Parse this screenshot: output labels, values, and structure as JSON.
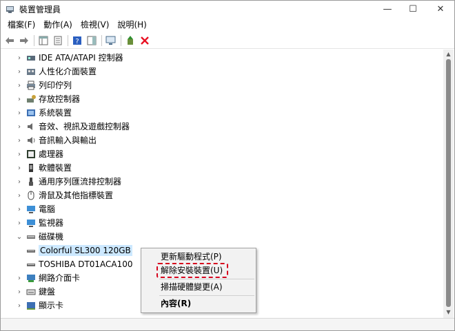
{
  "window": {
    "title": "裝置管理員",
    "minimize": "—",
    "maximize": "☐",
    "close": "✕"
  },
  "menu": [
    "檔案(F)",
    "動作(A)",
    "檢視(V)",
    "說明(H)"
  ],
  "tree": {
    "items": [
      {
        "label": "IDE ATA/ATAPI 控制器",
        "expander": "›",
        "icon": "ide-controller-icon"
      },
      {
        "label": "人性化介面裝置",
        "expander": "›",
        "icon": "hid-icon"
      },
      {
        "label": "列印佇列",
        "expander": "›",
        "icon": "printer-icon"
      },
      {
        "label": "存放控制器",
        "expander": "›",
        "icon": "storage-controller-icon"
      },
      {
        "label": "系統裝置",
        "expander": "›",
        "icon": "system-device-icon"
      },
      {
        "label": "音效、視訊及遊戲控制器",
        "expander": "›",
        "icon": "speaker-icon"
      },
      {
        "label": "音訊輸入與輸出",
        "expander": "›",
        "icon": "audio-io-icon"
      },
      {
        "label": "處理器",
        "expander": "›",
        "icon": "processor-icon"
      },
      {
        "label": "軟體裝置",
        "expander": "›",
        "icon": "software-device-icon"
      },
      {
        "label": "通用序列匯流排控制器",
        "expander": "›",
        "icon": "usb-icon"
      },
      {
        "label": "滑鼠及其他指標裝置",
        "expander": "›",
        "icon": "mouse-icon"
      },
      {
        "label": "電腦",
        "expander": "›",
        "icon": "computer-icon"
      },
      {
        "label": "監視器",
        "expander": "›",
        "icon": "monitor-icon"
      },
      {
        "label": "磁碟機",
        "expander": "⌄",
        "icon": "disk-drive-icon"
      },
      {
        "label": "Colorful SL300 120GB",
        "expander": "",
        "icon": "disk-icon",
        "child": true,
        "selected": true
      },
      {
        "label": "TOSHIBA DT01ACA100",
        "expander": "",
        "icon": "disk-icon",
        "child": true
      },
      {
        "label": "網路介面卡",
        "expander": "›",
        "icon": "network-adapter-icon"
      },
      {
        "label": "鍵盤",
        "expander": "›",
        "icon": "keyboard-icon"
      },
      {
        "label": "顯示卡",
        "expander": "›",
        "icon": "display-adapter-icon"
      }
    ]
  },
  "context_menu": {
    "update_driver": "更新驅動程式(P)",
    "uninstall_device": "解除安裝裝置(U)",
    "scan_hardware": "掃描硬體變更(A)",
    "properties": "內容(R)"
  },
  "colors": {
    "highlight": "#d6001c",
    "selection": "#cce8ff",
    "remove_x": "#e81123"
  }
}
